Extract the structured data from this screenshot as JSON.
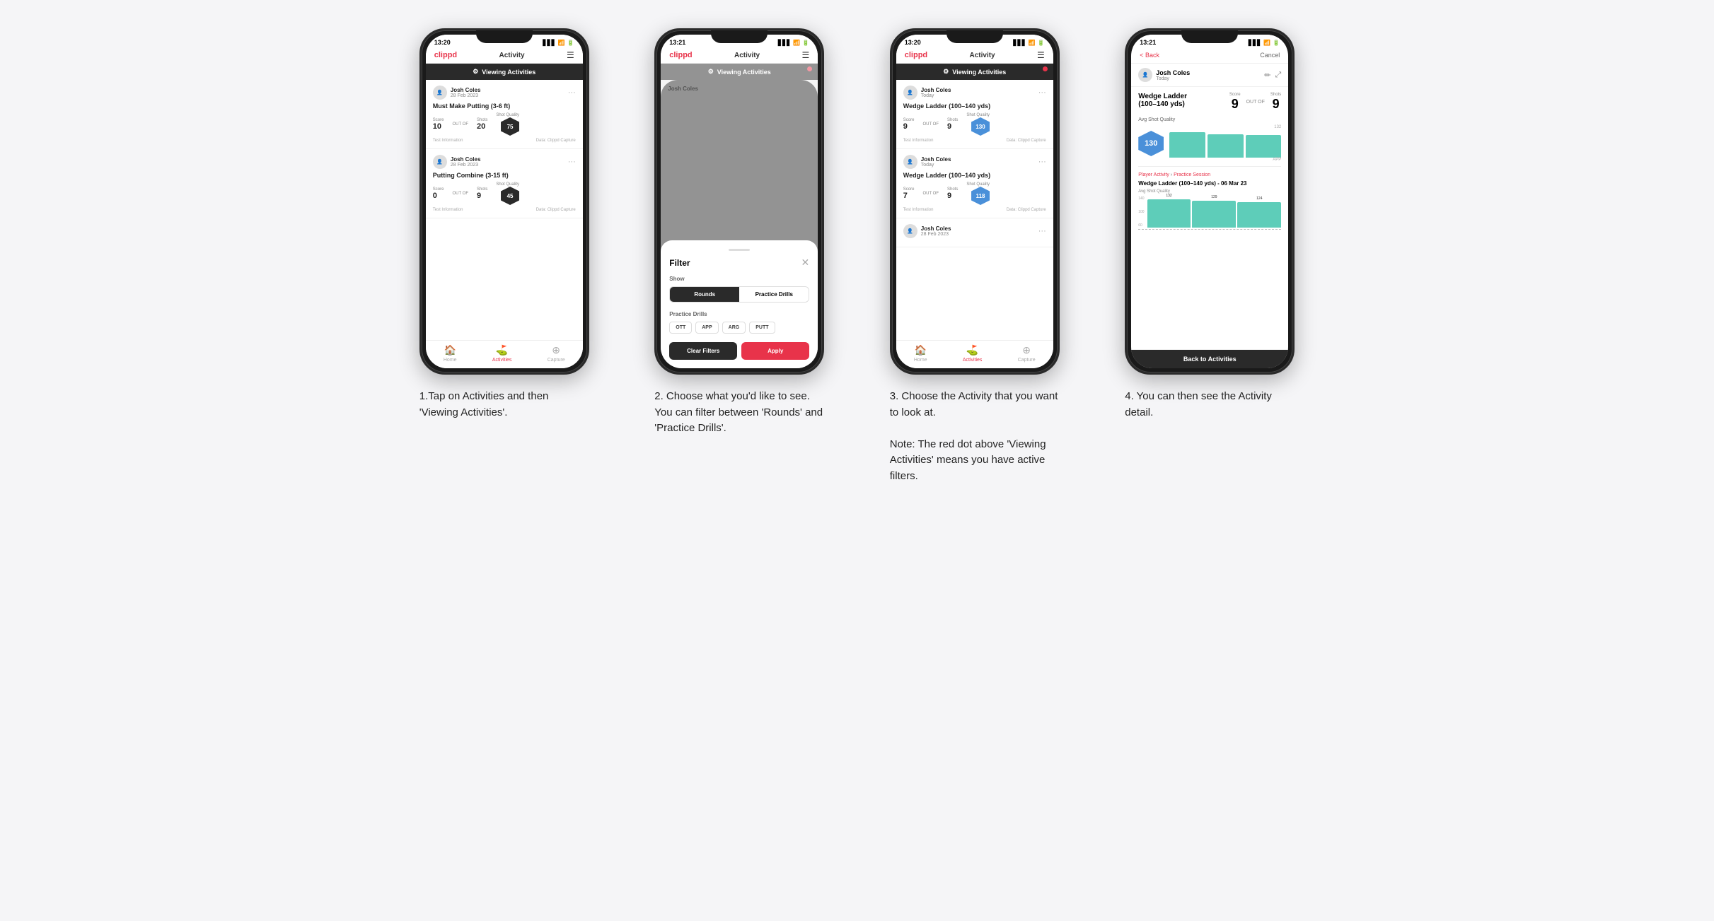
{
  "steps": [
    {
      "id": "step1",
      "caption": "1.Tap on Activities and then 'Viewing Activities'.",
      "phone": {
        "status_time": "13:20",
        "nav_logo": "clippd",
        "nav_title": "Activity",
        "viewing_banner": "Viewing Activities",
        "show_red_dot": false,
        "cards": [
          {
            "user_name": "Josh Coles",
            "user_date": "28 Feb 2023",
            "title": "Must Make Putting (3-6 ft)",
            "score_label": "Score",
            "score_value": "10",
            "shots_label": "Shots",
            "shots_value": "20",
            "sq_label": "Shot Quality",
            "sq_value": "75",
            "sq_color": "dark",
            "footer_left": "Test Information",
            "footer_right": "Data: Clippd Capture"
          },
          {
            "user_name": "Josh Coles",
            "user_date": "28 Feb 2023",
            "title": "Putting Combine (3-15 ft)",
            "score_label": "Score",
            "score_value": "0",
            "shots_label": "Shots",
            "shots_value": "9",
            "sq_label": "Shot Quality",
            "sq_value": "45",
            "sq_color": "dark",
            "footer_left": "Test Information",
            "footer_right": "Data: Clippd Capture"
          }
        ]
      }
    },
    {
      "id": "step2",
      "caption": "2. Choose what you'd like to see. You can filter between 'Rounds' and 'Practice Drills'.",
      "phone": {
        "status_time": "13:21",
        "nav_logo": "clippd",
        "nav_title": "Activity",
        "viewing_banner": "Viewing Activities",
        "show_red_dot": true,
        "filter": {
          "title": "Filter",
          "show_label": "Show",
          "toggle_rounds": "Rounds",
          "toggle_drills": "Practice Drills",
          "active_toggle": "rounds",
          "drills_label": "Practice Drills",
          "tags": [
            "OTT",
            "APP",
            "ARG",
            "PUTT"
          ],
          "btn_clear": "Clear Filters",
          "btn_apply": "Apply"
        }
      }
    },
    {
      "id": "step3",
      "caption": "3. Choose the Activity that you want to look at.\n\nNote: The red dot above 'Viewing Activities' means you have active filters.",
      "phone": {
        "status_time": "13:20",
        "nav_logo": "clippd",
        "nav_title": "Activity",
        "viewing_banner": "Viewing Activities",
        "show_red_dot": true,
        "cards": [
          {
            "user_name": "Josh Coles",
            "user_date": "Today",
            "title": "Wedge Ladder (100–140 yds)",
            "score_label": "Score",
            "score_value": "9",
            "shots_label": "Shots",
            "shots_value": "9",
            "sq_label": "Shot Quality",
            "sq_value": "130",
            "sq_color": "blue",
            "footer_left": "Test Information",
            "footer_right": "Data: Clippd Capture"
          },
          {
            "user_name": "Josh Coles",
            "user_date": "Today",
            "title": "Wedge Ladder (100–140 yds)",
            "score_label": "Score",
            "score_value": "7",
            "shots_label": "Shots",
            "shots_value": "9",
            "sq_label": "Shot Quality",
            "sq_value": "118",
            "sq_color": "blue",
            "footer_left": "Test Information",
            "footer_right": "Data: Clippd Capture"
          },
          {
            "user_name": "Josh Coles",
            "user_date": "28 Feb 2023",
            "title": "",
            "score_label": "",
            "score_value": "",
            "shots_label": "",
            "shots_value": "",
            "sq_label": "",
            "sq_value": "",
            "sq_color": "dark",
            "footer_left": "",
            "footer_right": ""
          }
        ]
      }
    },
    {
      "id": "step4",
      "caption": "4. You can then see the Activity detail.",
      "phone": {
        "status_time": "13:21",
        "back_label": "< Back",
        "cancel_label": "Cancel",
        "user_name": "Josh Coles",
        "user_date": "Today",
        "drill_name": "Wedge Ladder\n(100–140 yds)",
        "score_label": "Score",
        "score_value": "9",
        "outof_label": "OUT OF",
        "shots_label": "Shots",
        "shots_value": "9",
        "sq_value": "130",
        "avg_sq_label": "Avg Shot Quality",
        "chart_label": "APP",
        "chart_values": [
          132,
          129,
          124
        ],
        "chart_max": 140,
        "chart_y_labels": [
          "140",
          "100",
          "50",
          "0"
        ],
        "session_label": "Player Activity",
        "session_type": "Practice Session",
        "session_drill_title": "Wedge Ladder (100–140 yds) - 06 Mar 23",
        "session_drill_subtitle": "Avg Shot Quality",
        "back_to_activities": "Back to Activities"
      }
    }
  ]
}
